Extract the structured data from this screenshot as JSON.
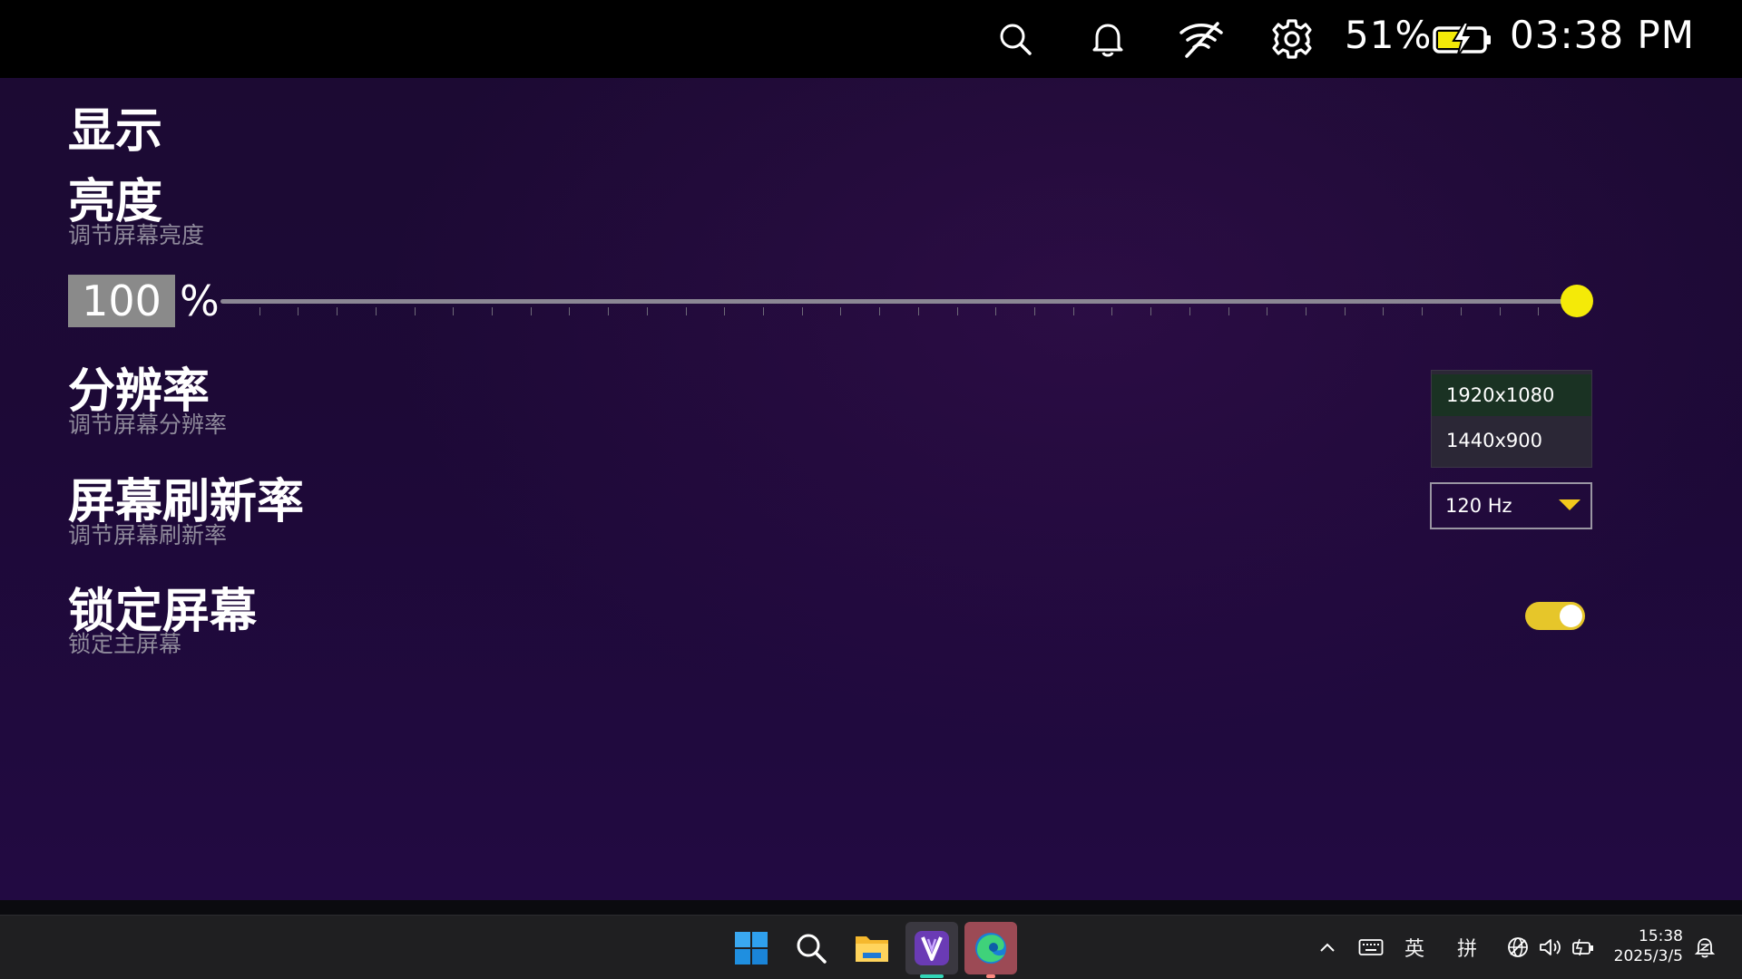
{
  "status_bar": {
    "battery_percent": "51%",
    "time": "03:38 PM",
    "icons": [
      "search-icon",
      "bell-icon",
      "wifi-off-icon",
      "gear-icon",
      "battery-charging-icon"
    ],
    "battery_level": 0.51
  },
  "page": {
    "title": "显示"
  },
  "brightness": {
    "title": "亮度",
    "subtitle": "调节屏幕亮度",
    "value": "100",
    "unit": "%",
    "level": 1.0
  },
  "resolution": {
    "title": "分辨率",
    "subtitle": "调节屏幕分辨率",
    "options": [
      "1920x1080",
      "1440x900"
    ],
    "selected": "1920x1080"
  },
  "refresh_rate": {
    "title": "屏幕刷新率",
    "subtitle": "调节屏幕刷新率",
    "value": "120 Hz"
  },
  "lock_screen": {
    "title": "锁定屏幕",
    "subtitle": "锁定主屏幕",
    "enabled": true
  },
  "taskbar": {
    "apps": [
      "windows-start-icon",
      "search-icon",
      "file-explorer-icon",
      "legion-app-icon",
      "edge-browser-icon"
    ],
    "ime_lang": "英",
    "ime_mode": "拼",
    "clock_time": "15:38",
    "clock_date": "2025/3/5"
  },
  "colors": {
    "accent_yellow": "#f4ea08",
    "toggle_on": "#e6c62a",
    "selected_option_bg": "#1a3223",
    "background": "#1d0937"
  }
}
